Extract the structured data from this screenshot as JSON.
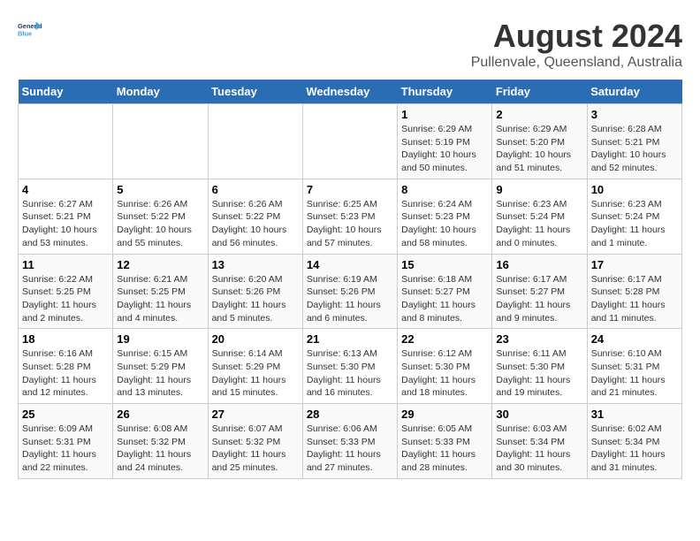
{
  "header": {
    "logo_line1": "General",
    "logo_line2": "Blue",
    "title": "August 2024",
    "subtitle": "Pullenvale, Queensland, Australia"
  },
  "weekdays": [
    "Sunday",
    "Monday",
    "Tuesday",
    "Wednesday",
    "Thursday",
    "Friday",
    "Saturday"
  ],
  "weeks": [
    [
      {
        "day": "",
        "info": ""
      },
      {
        "day": "",
        "info": ""
      },
      {
        "day": "",
        "info": ""
      },
      {
        "day": "",
        "info": ""
      },
      {
        "day": "1",
        "info": "Sunrise: 6:29 AM\nSunset: 5:19 PM\nDaylight: 10 hours\nand 50 minutes."
      },
      {
        "day": "2",
        "info": "Sunrise: 6:29 AM\nSunset: 5:20 PM\nDaylight: 10 hours\nand 51 minutes."
      },
      {
        "day": "3",
        "info": "Sunrise: 6:28 AM\nSunset: 5:21 PM\nDaylight: 10 hours\nand 52 minutes."
      }
    ],
    [
      {
        "day": "4",
        "info": "Sunrise: 6:27 AM\nSunset: 5:21 PM\nDaylight: 10 hours\nand 53 minutes."
      },
      {
        "day": "5",
        "info": "Sunrise: 6:26 AM\nSunset: 5:22 PM\nDaylight: 10 hours\nand 55 minutes."
      },
      {
        "day": "6",
        "info": "Sunrise: 6:26 AM\nSunset: 5:22 PM\nDaylight: 10 hours\nand 56 minutes."
      },
      {
        "day": "7",
        "info": "Sunrise: 6:25 AM\nSunset: 5:23 PM\nDaylight: 10 hours\nand 57 minutes."
      },
      {
        "day": "8",
        "info": "Sunrise: 6:24 AM\nSunset: 5:23 PM\nDaylight: 10 hours\nand 58 minutes."
      },
      {
        "day": "9",
        "info": "Sunrise: 6:23 AM\nSunset: 5:24 PM\nDaylight: 11 hours\nand 0 minutes."
      },
      {
        "day": "10",
        "info": "Sunrise: 6:23 AM\nSunset: 5:24 PM\nDaylight: 11 hours\nand 1 minute."
      }
    ],
    [
      {
        "day": "11",
        "info": "Sunrise: 6:22 AM\nSunset: 5:25 PM\nDaylight: 11 hours\nand 2 minutes."
      },
      {
        "day": "12",
        "info": "Sunrise: 6:21 AM\nSunset: 5:25 PM\nDaylight: 11 hours\nand 4 minutes."
      },
      {
        "day": "13",
        "info": "Sunrise: 6:20 AM\nSunset: 5:26 PM\nDaylight: 11 hours\nand 5 minutes."
      },
      {
        "day": "14",
        "info": "Sunrise: 6:19 AM\nSunset: 5:26 PM\nDaylight: 11 hours\nand 6 minutes."
      },
      {
        "day": "15",
        "info": "Sunrise: 6:18 AM\nSunset: 5:27 PM\nDaylight: 11 hours\nand 8 minutes."
      },
      {
        "day": "16",
        "info": "Sunrise: 6:17 AM\nSunset: 5:27 PM\nDaylight: 11 hours\nand 9 minutes."
      },
      {
        "day": "17",
        "info": "Sunrise: 6:17 AM\nSunset: 5:28 PM\nDaylight: 11 hours\nand 11 minutes."
      }
    ],
    [
      {
        "day": "18",
        "info": "Sunrise: 6:16 AM\nSunset: 5:28 PM\nDaylight: 11 hours\nand 12 minutes."
      },
      {
        "day": "19",
        "info": "Sunrise: 6:15 AM\nSunset: 5:29 PM\nDaylight: 11 hours\nand 13 minutes."
      },
      {
        "day": "20",
        "info": "Sunrise: 6:14 AM\nSunset: 5:29 PM\nDaylight: 11 hours\nand 15 minutes."
      },
      {
        "day": "21",
        "info": "Sunrise: 6:13 AM\nSunset: 5:30 PM\nDaylight: 11 hours\nand 16 minutes."
      },
      {
        "day": "22",
        "info": "Sunrise: 6:12 AM\nSunset: 5:30 PM\nDaylight: 11 hours\nand 18 minutes."
      },
      {
        "day": "23",
        "info": "Sunrise: 6:11 AM\nSunset: 5:30 PM\nDaylight: 11 hours\nand 19 minutes."
      },
      {
        "day": "24",
        "info": "Sunrise: 6:10 AM\nSunset: 5:31 PM\nDaylight: 11 hours\nand 21 minutes."
      }
    ],
    [
      {
        "day": "25",
        "info": "Sunrise: 6:09 AM\nSunset: 5:31 PM\nDaylight: 11 hours\nand 22 minutes."
      },
      {
        "day": "26",
        "info": "Sunrise: 6:08 AM\nSunset: 5:32 PM\nDaylight: 11 hours\nand 24 minutes."
      },
      {
        "day": "27",
        "info": "Sunrise: 6:07 AM\nSunset: 5:32 PM\nDaylight: 11 hours\nand 25 minutes."
      },
      {
        "day": "28",
        "info": "Sunrise: 6:06 AM\nSunset: 5:33 PM\nDaylight: 11 hours\nand 27 minutes."
      },
      {
        "day": "29",
        "info": "Sunrise: 6:05 AM\nSunset: 5:33 PM\nDaylight: 11 hours\nand 28 minutes."
      },
      {
        "day": "30",
        "info": "Sunrise: 6:03 AM\nSunset: 5:34 PM\nDaylight: 11 hours\nand 30 minutes."
      },
      {
        "day": "31",
        "info": "Sunrise: 6:02 AM\nSunset: 5:34 PM\nDaylight: 11 hours\nand 31 minutes."
      }
    ]
  ]
}
